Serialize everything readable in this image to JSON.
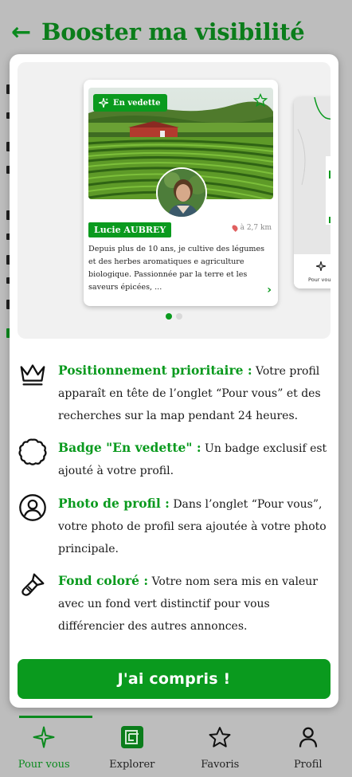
{
  "header": {
    "title": "Booster ma visibilité"
  },
  "card": {
    "badge": "En vedette",
    "name": "Lucie AUBREY",
    "distance": "à 2,7 km",
    "description": "Depuis plus de 10 ans, je cultive des légumes et des herbes aromatiques e agriculture biologique. Passionnée par la terre et les saveurs épicées, ..."
  },
  "card2": {
    "label": "Pour vous"
  },
  "carousel": {
    "dots": 2,
    "active_index": 0
  },
  "features": [
    {
      "icon": "crown-icon",
      "title": "Positionnement prioritaire :",
      "text": "Votre profil apparaît en tête de l’onglet “Pour vous” et des recherches sur la map pendant 24 heures."
    },
    {
      "icon": "badge-icon",
      "title": "Badge \"En vedette\" :",
      "text": "Un badge exclusif est ajouté à votre profil."
    },
    {
      "icon": "profile-circle-icon",
      "title": "Photo de profil :",
      "text": "Dans l’onglet “Pour vous”, votre photo de profil sera ajoutée à votre photo principale."
    },
    {
      "icon": "paintbrush-icon",
      "title": "Fond coloré :",
      "text": "Votre nom sera mis en valeur avec un fond vert distinctif pour vous différencier des autres annonces."
    }
  ],
  "cta_label": "J'ai compris !",
  "bottom_nav": [
    {
      "label": "Pour vous",
      "icon": "sparkle-icon",
      "active": true
    },
    {
      "label": "Explorer",
      "icon": "explorer-icon",
      "active": false
    },
    {
      "label": "Favoris",
      "icon": "star-icon",
      "active": false
    },
    {
      "label": "Profil",
      "icon": "person-icon",
      "active": false
    }
  ],
  "colors": {
    "brand_green": "#0a9a1e",
    "title_green": "#0b7d1b",
    "overlay": "#bdbdbd"
  }
}
